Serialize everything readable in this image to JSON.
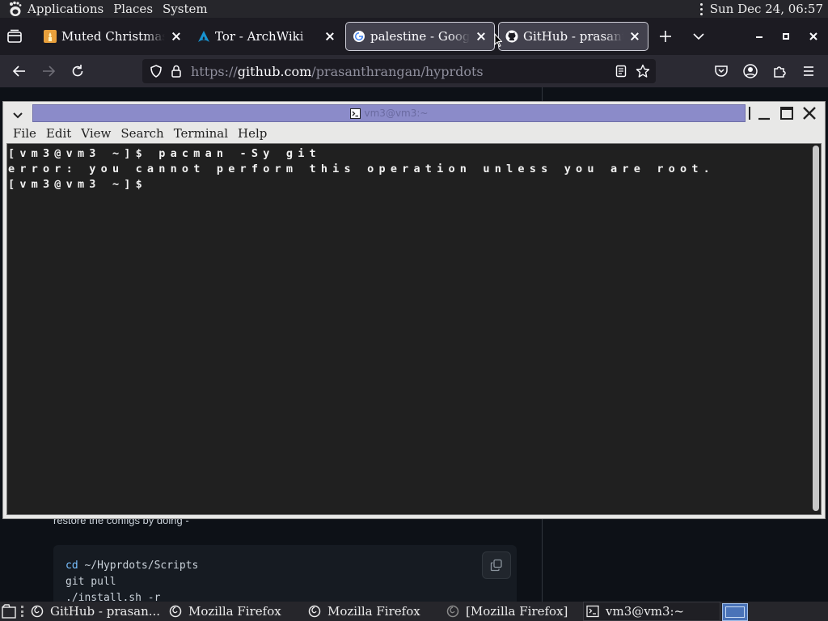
{
  "top_panel": {
    "menus": [
      "Applications",
      "Places",
      "System"
    ],
    "clock": "Sun Dec 24, 06:57"
  },
  "browser": {
    "tabs": [
      {
        "title": "Muted Christmas",
        "favicon": "candle-icon",
        "selected": false
      },
      {
        "title": "Tor - ArchWiki",
        "favicon": "arch-logo-icon",
        "selected": false
      },
      {
        "title": "palestine - Google",
        "favicon": "google-icon",
        "selected": true
      },
      {
        "title": "GitHub - prasanth",
        "favicon": "github-icon",
        "selected": true
      }
    ],
    "url_prefix": "https://",
    "url_host": "github.com",
    "url_path": "/prasanthrangan/hyprdots"
  },
  "page": {
    "restore_text": "restore the configs by doing -",
    "code_lines": [
      {
        "kw": "cd",
        "rest": " ~/Hyprdots/Scripts"
      },
      {
        "kw": "",
        "rest": "git pull"
      },
      {
        "kw": "",
        "rest": "./install.sh -r"
      }
    ]
  },
  "terminal": {
    "window_title": "vm3@vm3:~",
    "menu": [
      "File",
      "Edit",
      "View",
      "Search",
      "Terminal",
      "Help"
    ],
    "lines": [
      "[vm3@vm3 ~]$ pacman -Sy git",
      "error: you cannot perform this operation unless you are root.",
      "[vm3@vm3 ~]$ "
    ]
  },
  "taskbar": {
    "items": [
      {
        "label": "GitHub - prasan...",
        "icon": "firefox-icon",
        "active": false
      },
      {
        "label": "Mozilla Firefox",
        "icon": "firefox-icon",
        "active": false
      },
      {
        "label": "Mozilla Firefox",
        "icon": "firefox-icon",
        "active": false
      },
      {
        "label": "[Mozilla Firefox]",
        "icon": "firefox-icon",
        "active": false
      },
      {
        "label": "vm3@vm3:~",
        "icon": "terminal-icon",
        "active": true
      }
    ]
  },
  "colors": {
    "panel_bg": "#26262b",
    "firefox_bg": "#1c1b22",
    "terminal_title_strip": "#8b8bc9",
    "terminal_bg": "#202020",
    "workspace_active": "#4a73b8"
  }
}
